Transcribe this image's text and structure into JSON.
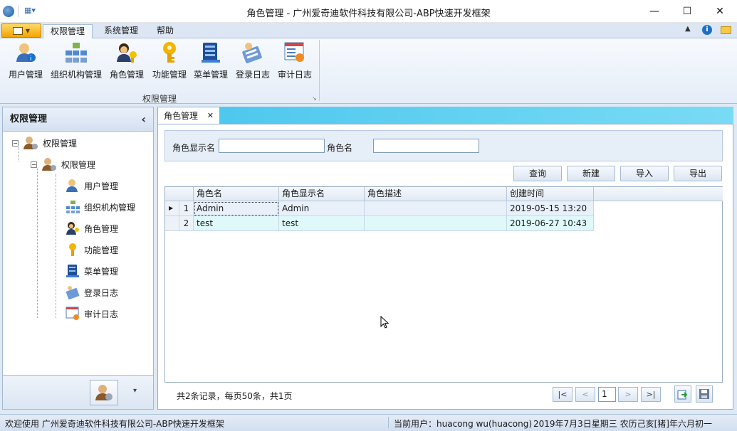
{
  "window": {
    "title": "角色管理 - 广州爱奇迪软件科技有限公司-ABP快速开发框架",
    "minimize": "—",
    "maximize": "☐",
    "close": "✕"
  },
  "ribbon": {
    "tabs": [
      "权限管理",
      "系统管理",
      "帮助"
    ],
    "buttons": [
      "用户管理",
      "组织机构管理",
      "角色管理",
      "功能管理",
      "菜单管理",
      "登录日志",
      "审计日志"
    ],
    "group_label": "权限管理"
  },
  "left": {
    "header": "权限管理",
    "collapse": "‹",
    "tree_root": "权限管理",
    "tree_child": "权限管理",
    "items": [
      "用户管理",
      "组织机构管理",
      "角色管理",
      "功能管理",
      "菜单管理",
      "登录日志",
      "审计日志"
    ],
    "footer_arrow": "▾"
  },
  "doc_tab": {
    "label": "角色管理",
    "close": "✕"
  },
  "search": {
    "label1": "角色显示名",
    "value1": "",
    "label2": "角色名",
    "value2": ""
  },
  "actions": [
    "查询",
    "新建",
    "导入",
    "导出"
  ],
  "grid": {
    "columns": [
      "角色名",
      "角色显示名",
      "角色描述",
      "创建时间"
    ],
    "rows": [
      {
        "n": "1",
        "name": "Admin",
        "display": "Admin",
        "desc": "",
        "created": "2019-05-15 13:20"
      },
      {
        "n": "2",
        "name": "test",
        "display": "test",
        "desc": "",
        "created": "2019-06-27 10:43"
      }
    ]
  },
  "pager": {
    "summary": "共2条记录，每页50条，共1页",
    "first": "|<",
    "prev": "<",
    "page": "1",
    "next": ">",
    "last": ">|"
  },
  "status": {
    "welcome": "欢迎使用 广州爱奇迪软件科技有限公司-ABP快速开发框架",
    "user": "当前用户：huacong wu(huacong)",
    "date": "2019年7月3日星期三 农历己亥[猪]年六月初一"
  },
  "colors": {
    "accent": "#4fc8ee",
    "row_alt": "#dff9fb",
    "row_selected": "#e8f0fa"
  }
}
